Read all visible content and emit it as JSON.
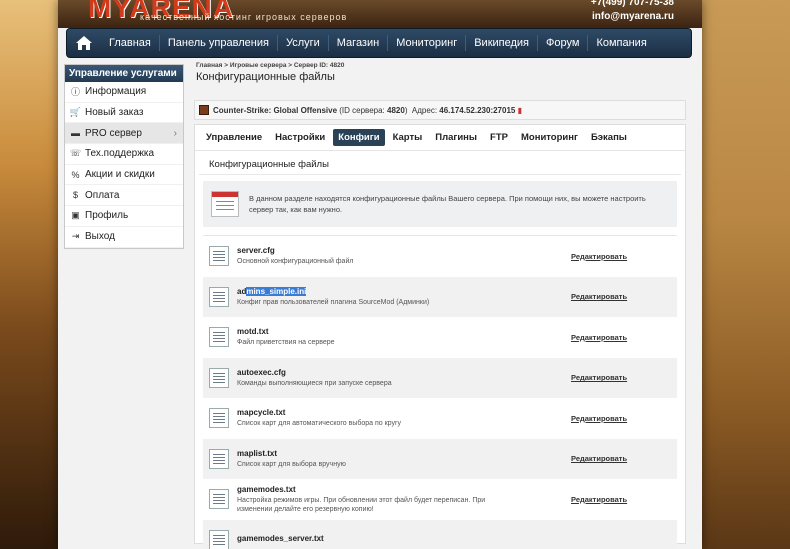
{
  "header": {
    "logo": "MYARENA",
    "tagline": "качественный хостинг игровых серверов",
    "phone": "+7(499) 707-75-38",
    "email": "info@myarena.ru"
  },
  "nav": [
    "Главная",
    "Панель управления",
    "Услуги",
    "Магазин",
    "Мониторинг",
    "Википедия",
    "Форум",
    "Компания"
  ],
  "sidebar": {
    "title": "Управление услугами",
    "items": [
      {
        "label": "Информация",
        "icon": "info-icon"
      },
      {
        "label": "Новый заказ",
        "icon": "cart-icon"
      },
      {
        "label": "PRO сервер",
        "icon": "server-icon"
      },
      {
        "label": "Тех.поддержка",
        "icon": "support-icon"
      },
      {
        "label": "Акции и скидки",
        "icon": "discount-icon"
      },
      {
        "label": "Оплата",
        "icon": "dollar-icon"
      },
      {
        "label": "Профиль",
        "icon": "profile-icon"
      },
      {
        "label": "Выход",
        "icon": "exit-icon"
      }
    ]
  },
  "breadcrumb": "Главная > Игровые сервера > Сервер ID: 4820",
  "page_title": "Конфигурационные файлы",
  "server": {
    "game": "Counter-Strike: Global Offensive",
    "id_text": "(ID сервера:",
    "id": "4820",
    "addr_label": "Адрес:",
    "addr": "46.174.52.230:27015"
  },
  "tabs": [
    "Управление",
    "Настройки",
    "Конфиги",
    "Карты",
    "Плагины",
    "FTP",
    "Мониторинг",
    "Бэкапы"
  ],
  "section_title": "Конфигурационные файлы",
  "info_text": "В данном разделе находятся конфигурационные файлы Вашего сервера. При помощи них, вы можете настроить сервер так, как вам нужно.",
  "edit_label": "Редактировать",
  "files": [
    {
      "name": "server.cfg",
      "desc": "Основной конфигурационный файл"
    },
    {
      "name_a": "ad",
      "name_sel": "mins_simple.ini",
      "desc": "Конфиг прав пользователей плагина SourceMod (Админки)"
    },
    {
      "name": "motd.txt",
      "desc": "Файл приветствия на сервере"
    },
    {
      "name": "autoexec.cfg",
      "desc": "Команды выполняющиеся при запуске сервера"
    },
    {
      "name": "mapcycle.txt",
      "desc": "Список карт для автоматического выбора по кругу"
    },
    {
      "name": "maplist.txt",
      "desc": "Список карт для выбора вручную"
    },
    {
      "name": "gamemodes.txt",
      "desc": "Настройка режимов игры. При обновлении этот файл будет переписан. При изменении делайте его резервную копию!"
    },
    {
      "name": "gamemodes_server.txt",
      "desc": ""
    }
  ]
}
